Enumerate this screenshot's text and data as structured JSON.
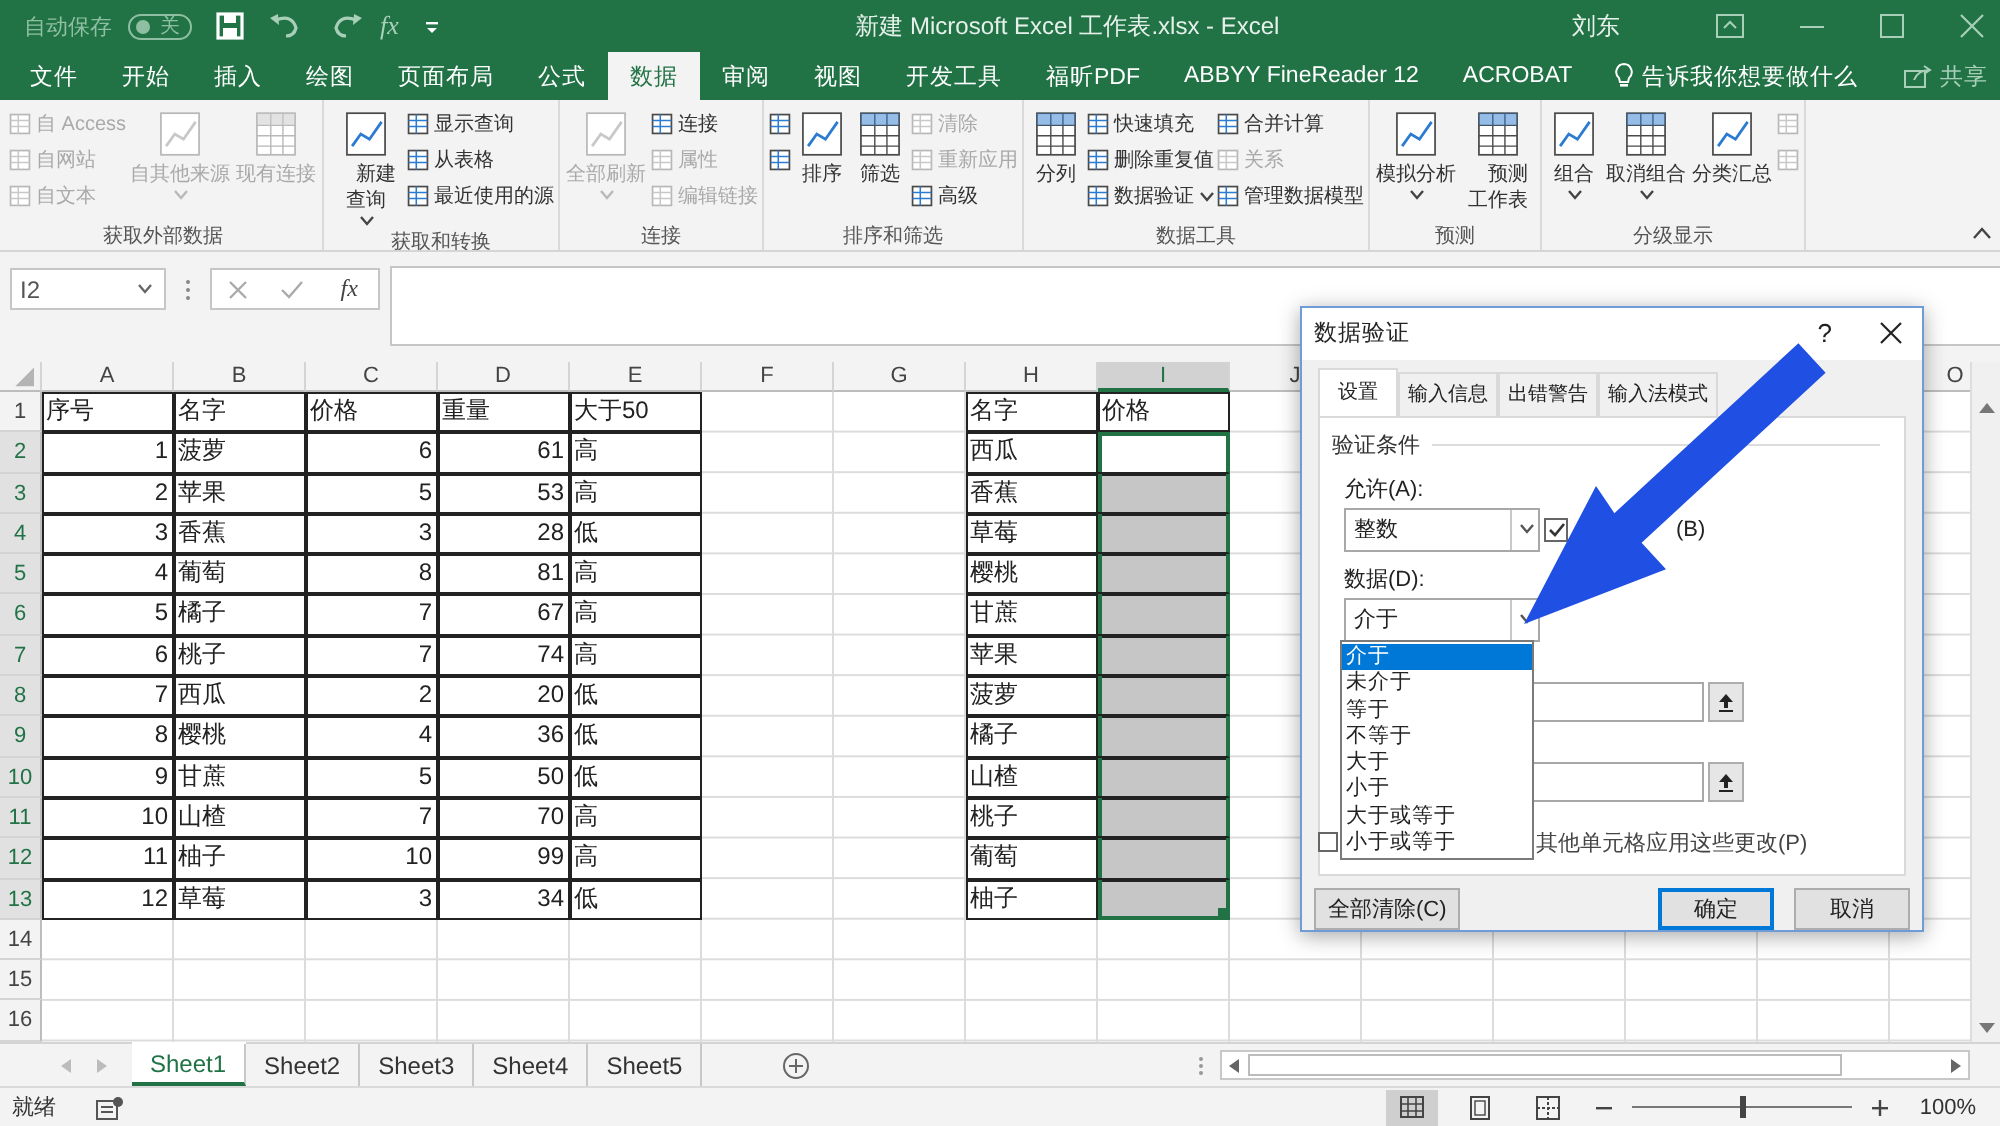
{
  "title_bar": {
    "autosave_label": "自动保存",
    "autosave_toggle": {
      "on": false,
      "label": "关"
    },
    "formula_button": "fx",
    "document_title": "新建 Microsoft Excel 工作表.xlsx  -  Excel",
    "user": "刘东"
  },
  "ribbon_tabs": [
    {
      "label": "文件",
      "selected": false
    },
    {
      "label": "开始",
      "selected": false
    },
    {
      "label": "插入",
      "selected": false
    },
    {
      "label": "绘图",
      "selected": false
    },
    {
      "label": "页面布局",
      "selected": false
    },
    {
      "label": "公式",
      "selected": false
    },
    {
      "label": "数据",
      "selected": true
    },
    {
      "label": "审阅",
      "selected": false
    },
    {
      "label": "视图",
      "selected": false
    },
    {
      "label": "开发工具",
      "selected": false
    },
    {
      "label": "福昕PDF",
      "selected": false
    },
    {
      "label": "ABBYY FineReader 12",
      "selected": false
    },
    {
      "label": "ACROBAT",
      "selected": false
    }
  ],
  "tell_me": "告诉我你想要做什么",
  "share": "共享",
  "ribbon_groups": [
    {
      "label": "获取外部数据",
      "columns": [
        [
          {
            "kind": "small",
            "label": "自 Access",
            "disabled": true
          },
          {
            "kind": "small",
            "label": "自网站",
            "disabled": true
          },
          {
            "kind": "small",
            "label": "自文本",
            "disabled": true
          }
        ],
        [
          {
            "kind": "large",
            "label": "自其他来源",
            "disabled": true,
            "dropdown": true
          }
        ],
        [
          {
            "kind": "large",
            "label": "现有连接",
            "disabled": true
          }
        ]
      ]
    },
    {
      "label": "获取和转换",
      "columns": [
        [
          {
            "kind": "stacked",
            "label": "新建查询",
            "disabled": false,
            "dropdown": true
          }
        ],
        [
          {
            "kind": "small",
            "label": "显示查询",
            "disabled": false
          },
          {
            "kind": "small",
            "label": "从表格",
            "disabled": false
          },
          {
            "kind": "small",
            "label": "最近使用的源",
            "disabled": false
          }
        ]
      ]
    },
    {
      "label": "连接",
      "columns": [
        [
          {
            "kind": "large",
            "label": "全部刷新",
            "disabled": true,
            "dropdown": true
          }
        ],
        [
          {
            "kind": "small",
            "label": "连接",
            "disabled": false
          },
          {
            "kind": "small",
            "label": "属性",
            "disabled": true
          },
          {
            "kind": "small",
            "label": "编辑链接",
            "disabled": true
          }
        ]
      ]
    },
    {
      "label": "排序和筛选",
      "columns": [
        [
          {
            "kind": "small",
            "disabled": false
          },
          {
            "kind": "small",
            "disabled": false
          }
        ],
        [
          {
            "kind": "large",
            "label": "排序",
            "disabled": false
          }
        ],
        [
          {
            "kind": "large",
            "label": "筛选",
            "disabled": false
          }
        ],
        [
          {
            "kind": "small",
            "label": "清除",
            "disabled": true
          },
          {
            "kind": "small",
            "label": "重新应用",
            "disabled": true
          },
          {
            "kind": "small",
            "label": "高级",
            "disabled": false
          }
        ]
      ]
    },
    {
      "label": "数据工具",
      "columns": [
        [
          {
            "kind": "large",
            "label": "分列",
            "disabled": false
          }
        ],
        [
          {
            "kind": "small",
            "label": "快速填充",
            "disabled": false
          },
          {
            "kind": "small",
            "label": "删除重复值",
            "disabled": false
          },
          {
            "kind": "small",
            "label": "数据验证",
            "disabled": false,
            "dropdown": true
          }
        ],
        [
          {
            "kind": "small",
            "label": "合并计算",
            "disabled": false
          },
          {
            "kind": "small",
            "label": "关系",
            "disabled": true
          },
          {
            "kind": "small",
            "label": "管理数据模型",
            "disabled": false
          }
        ]
      ]
    },
    {
      "label": "预测",
      "columns": [
        [
          {
            "kind": "large",
            "label": "模拟分析",
            "disabled": false,
            "dropdown": true
          }
        ],
        [
          {
            "kind": "stacked",
            "label": "预测工作表",
            "disabled": false
          }
        ]
      ]
    },
    {
      "label": "分级显示",
      "columns": [
        [
          {
            "kind": "large",
            "label": "组合",
            "disabled": false,
            "dropdown": true
          }
        ],
        [
          {
            "kind": "large",
            "label": "取消组合",
            "disabled": false,
            "dropdown": true
          }
        ],
        [
          {
            "kind": "large",
            "label": "分类汇总",
            "disabled": false
          }
        ],
        [
          {
            "kind": "small",
            "disabled": true
          },
          {
            "kind": "small",
            "disabled": true
          }
        ]
      ]
    }
  ],
  "formula_bar": {
    "name_box": "I2",
    "function_label": "fx"
  },
  "sheet": {
    "column_headers": [
      {
        "label": "A",
        "selected": false
      },
      {
        "label": "B",
        "selected": false
      },
      {
        "label": "C",
        "selected": false
      },
      {
        "label": "D",
        "selected": false
      },
      {
        "label": "E",
        "selected": false
      },
      {
        "label": "F",
        "selected": false
      },
      {
        "label": "G",
        "selected": false
      },
      {
        "label": "H",
        "selected": false
      },
      {
        "label": "I",
        "selected": true
      },
      {
        "label": "J",
        "selected": false
      }
    ],
    "last_column_header": "O",
    "row_headers": [
      "1",
      "2",
      "3",
      "4",
      "5",
      "6",
      "7",
      "8",
      "9",
      "10",
      "11",
      "12",
      "13",
      "14",
      "15",
      "16"
    ],
    "main_table": {
      "header": [
        "序号",
        "名字",
        "价格",
        "重量",
        "大于50"
      ],
      "rows": [
        [
          "1",
          "菠萝",
          "6",
          "61",
          "高"
        ],
        [
          "2",
          "苹果",
          "5",
          "53",
          "高"
        ],
        [
          "3",
          "香蕉",
          "3",
          "28",
          "低"
        ],
        [
          "4",
          "葡萄",
          "8",
          "81",
          "高"
        ],
        [
          "5",
          "橘子",
          "7",
          "67",
          "高"
        ],
        [
          "6",
          "桃子",
          "7",
          "74",
          "高"
        ],
        [
          "7",
          "西瓜",
          "2",
          "20",
          "低"
        ],
        [
          "8",
          "樱桃",
          "4",
          "36",
          "低"
        ],
        [
          "9",
          "甘蔗",
          "5",
          "50",
          "低"
        ],
        [
          "10",
          "山楂",
          "7",
          "70",
          "高"
        ],
        [
          "11",
          "柚子",
          "10",
          "99",
          "高"
        ],
        [
          "12",
          "草莓",
          "3",
          "34",
          "低"
        ]
      ]
    },
    "lookup_table": {
      "header": [
        "名字",
        "价格"
      ],
      "rows": [
        {
          "name": "西瓜",
          "selected": true,
          "active": true
        },
        {
          "name": "香蕉",
          "selected": true,
          "active": false
        },
        {
          "name": "草莓",
          "selected": true,
          "active": false
        },
        {
          "name": "樱桃",
          "selected": true,
          "active": false
        },
        {
          "name": "甘蔗",
          "selected": true,
          "active": false
        },
        {
          "name": "苹果",
          "selected": true,
          "active": false
        },
        {
          "name": "菠萝",
          "selected": true,
          "active": false
        },
        {
          "name": "橘子",
          "selected": true,
          "active": false
        },
        {
          "name": "山楂",
          "selected": true,
          "active": false
        },
        {
          "name": "桃子",
          "selected": true,
          "active": false
        },
        {
          "name": "葡萄",
          "selected": true,
          "active": false
        },
        {
          "name": "柚子",
          "selected": true,
          "active": false
        }
      ]
    }
  },
  "dialog": {
    "title": "数据验证",
    "help": "?",
    "tabs": [
      {
        "label": "设置",
        "selected": true
      },
      {
        "label": "输入信息",
        "selected": false
      },
      {
        "label": "出错警告",
        "selected": false
      },
      {
        "label": "输入法模式",
        "selected": false
      }
    ],
    "section": "验证条件",
    "allow_label": "允许(A):",
    "allow_value": "整数",
    "ignore_blank": {
      "label": "(B)",
      "checked": true
    },
    "data_label": "数据(D):",
    "data_value": "介于",
    "data_options": [
      {
        "label": "介于",
        "selected": true
      },
      {
        "label": "未介于",
        "selected": false
      },
      {
        "label": "等于",
        "selected": false
      },
      {
        "label": "不等于",
        "selected": false
      },
      {
        "label": "大于",
        "selected": false
      },
      {
        "label": "小于",
        "selected": false
      },
      {
        "label": "大于或等于",
        "selected": false
      },
      {
        "label": "小于或等于",
        "selected": false
      }
    ],
    "apply_all": {
      "label": "其他单元格应用这些更改(P)",
      "checked": false
    },
    "buttons": [
      {
        "label": "全部清除(C)",
        "kind": "secondary"
      },
      {
        "label": "确定",
        "kind": "default"
      },
      {
        "label": "取消",
        "kind": "secondary"
      }
    ]
  },
  "sheet_tabs": [
    {
      "label": "Sheet1",
      "selected": true
    },
    {
      "label": "Sheet2",
      "selected": false
    },
    {
      "label": "Sheet3",
      "selected": false
    },
    {
      "label": "Sheet4",
      "selected": false
    },
    {
      "label": "Sheet5",
      "selected": false
    }
  ],
  "status_bar": {
    "status": "就绪",
    "zoom_slider": {
      "level": 0.5
    },
    "zoom": "100%"
  }
}
